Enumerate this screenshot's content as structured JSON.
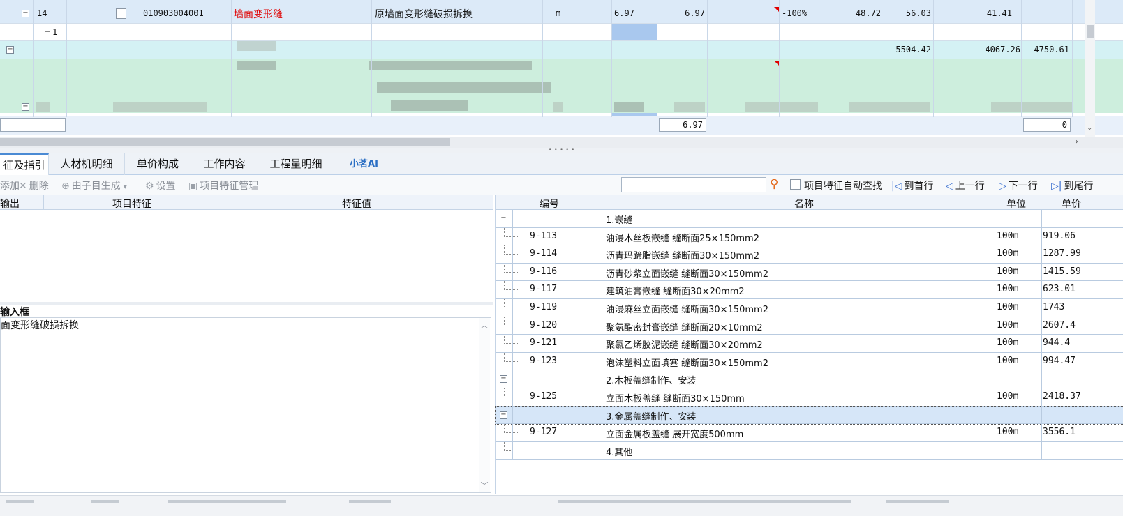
{
  "top_grid": {
    "row14": {
      "seq": "14",
      "code": "010903004001",
      "type": "墙面变形缝",
      "description": "原墙面变形缝破损拆换",
      "unit": "m",
      "qty1": "6.97",
      "qty2": "6.97",
      "pct": "-100%",
      "v1": "48.72",
      "v2": "56.03",
      "v3": "41.41"
    },
    "sub_row": {
      "seq": "1"
    },
    "group_row": {
      "v1": "5504.42",
      "v2": "4067.26",
      "v3": "4750.61"
    },
    "footer": {
      "qty": "6.97",
      "last": "0"
    },
    "colors": {
      "highlight_column": "#a9c8ee",
      "group_row": "#d4f1f4",
      "blurred_block": "#cdeedd",
      "red_text": "#e00000"
    }
  },
  "tabs": [
    {
      "label": "征及指引"
    },
    {
      "label": "人材机明细"
    },
    {
      "label": "单价构成"
    },
    {
      "label": "工作内容"
    },
    {
      "label": "工程量明细"
    },
    {
      "label": "小茗AI"
    }
  ],
  "toolbar": {
    "add": "添加",
    "delete": "删除",
    "generate": "由子目生成",
    "settings": "设置",
    "manage": "项目特征管理",
    "auto_find": "项目特征自动查找",
    "first": "到首行",
    "prev": "上一行",
    "next": "下一行",
    "last": "到尾行"
  },
  "left_panel": {
    "headers": {
      "output": "输出",
      "feature": "项目特征",
      "value": "特征值"
    },
    "input_label": "输入框",
    "input_text": "面变形缝破损拆换"
  },
  "right_panel": {
    "headers": {
      "code": "编号",
      "name": "名称",
      "unit": "单位",
      "price": "单价"
    },
    "rows": [
      {
        "kind": "group",
        "code": "",
        "name": "1.嵌缝",
        "unit": "",
        "price": ""
      },
      {
        "kind": "item",
        "code": "9-113",
        "name": "油浸木丝板嵌缝 缝断面25×150mm2",
        "unit": "100m",
        "price": "919.06"
      },
      {
        "kind": "item",
        "code": "9-114",
        "name": "沥青玛蹄脂嵌缝 缝断面30×150mm2",
        "unit": "100m",
        "price": "1287.99"
      },
      {
        "kind": "item",
        "code": "9-116",
        "name": "沥青砂浆立面嵌缝 缝断面30×150mm2",
        "unit": "100m",
        "price": "1415.59"
      },
      {
        "kind": "item",
        "code": "9-117",
        "name": "建筑油膏嵌缝 缝断面30×20mm2",
        "unit": "100m",
        "price": "623.01"
      },
      {
        "kind": "item",
        "code": "9-119",
        "name": "油浸麻丝立面嵌缝 缝断面30×150mm2",
        "unit": "100m",
        "price": "1743"
      },
      {
        "kind": "item",
        "code": "9-120",
        "name": "聚氨酯密封膏嵌缝 缝断面20×10mm2",
        "unit": "100m",
        "price": "2607.4"
      },
      {
        "kind": "item",
        "code": "9-121",
        "name": "聚氯乙烯胶泥嵌缝 缝断面30×20mm2",
        "unit": "100m",
        "price": "944.4"
      },
      {
        "kind": "item",
        "code": "9-123",
        "name": "泡沫塑料立面填塞 缝断面30×150mm2",
        "unit": "100m",
        "price": "994.47"
      },
      {
        "kind": "group",
        "code": "",
        "name": "2.木板盖缝制作、安装",
        "unit": "",
        "price": ""
      },
      {
        "kind": "item",
        "code": "9-125",
        "name": "立面木板盖缝 缝断面30×150mm",
        "unit": "100m",
        "price": "2418.37"
      },
      {
        "kind": "group",
        "code": "",
        "name": "3.金属盖缝制作、安装",
        "unit": "",
        "price": ""
      },
      {
        "kind": "item",
        "code": "9-127",
        "name": "立面金属板盖缝 展开宽度500mm",
        "unit": "100m",
        "price": "3556.1"
      },
      {
        "kind": "leaf-group",
        "code": "",
        "name": "4.其他",
        "unit": "",
        "price": ""
      }
    ]
  }
}
